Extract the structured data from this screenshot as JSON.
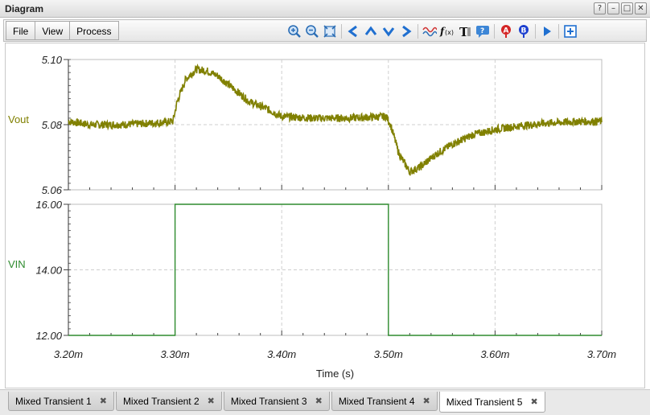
{
  "window": {
    "title": "Diagram",
    "buttons": [
      "?",
      "–",
      "□",
      "✕"
    ]
  },
  "menu": [
    "File",
    "View",
    "Process"
  ],
  "toolbar_icons": [
    "zoom-in-icon",
    "zoom-out-icon",
    "fit-icon",
    "arrow-left-icon",
    "arrow-up-icon",
    "arrow-down-icon",
    "arrow-right-icon",
    "waveform-icon",
    "function-icon",
    "text-icon",
    "comment-icon",
    "cursor-a-icon",
    "cursor-b-icon",
    "run-icon",
    "export-icon"
  ],
  "tabs": [
    {
      "label": "Mixed Transient 1",
      "active": false
    },
    {
      "label": "Mixed Transient 2",
      "active": false
    },
    {
      "label": "Mixed Transient 3",
      "active": false
    },
    {
      "label": "Mixed Transient 4",
      "active": false
    },
    {
      "label": "Mixed Transient 5",
      "active": true
    }
  ],
  "chart_data": [
    {
      "type": "line",
      "series": [
        {
          "name": "Vout",
          "color": "#808000"
        }
      ],
      "ylabel": "Vout",
      "ylim": [
        5.06,
        5.1
      ],
      "yticks": [
        "5.06",
        "5.08",
        "5.10"
      ],
      "xlim": [
        3.2,
        3.7
      ],
      "points": [
        [
          3.2,
          5.081
        ],
        [
          3.22,
          5.08
        ],
        [
          3.25,
          5.08
        ],
        [
          3.28,
          5.0805
        ],
        [
          3.298,
          5.081
        ],
        [
          3.302,
          5.087
        ],
        [
          3.31,
          5.094
        ],
        [
          3.32,
          5.097
        ],
        [
          3.33,
          5.0965
        ],
        [
          3.34,
          5.095
        ],
        [
          3.355,
          5.091
        ],
        [
          3.37,
          5.087
        ],
        [
          3.385,
          5.085
        ],
        [
          3.4,
          5.0825
        ],
        [
          3.43,
          5.082
        ],
        [
          3.46,
          5.082
        ],
        [
          3.498,
          5.0825
        ],
        [
          3.502,
          5.08
        ],
        [
          3.51,
          5.071
        ],
        [
          3.52,
          5.0655
        ],
        [
          3.53,
          5.067
        ],
        [
          3.545,
          5.071
        ],
        [
          3.56,
          5.074
        ],
        [
          3.58,
          5.077
        ],
        [
          3.6,
          5.0785
        ],
        [
          3.62,
          5.0795
        ],
        [
          3.65,
          5.0805
        ],
        [
          3.68,
          5.081
        ],
        [
          3.7,
          5.081
        ]
      ],
      "noise": 0.0012
    },
    {
      "type": "line",
      "series": [
        {
          "name": "VIN",
          "color": "#2e8b2e"
        }
      ],
      "ylabel": "VIN",
      "ylim": [
        12.0,
        16.0
      ],
      "yticks": [
        "12.00",
        "14.00",
        "16.00"
      ],
      "xlim": [
        3.2,
        3.7
      ],
      "points": [
        [
          3.2,
          12.0
        ],
        [
          3.3,
          12.0
        ],
        [
          3.3,
          16.0
        ],
        [
          3.5,
          16.0
        ],
        [
          3.5,
          12.0
        ],
        [
          3.7,
          12.0
        ]
      ]
    }
  ],
  "xaxis": {
    "label": "Time (s)",
    "ticks": [
      "3.20m",
      "3.30m",
      "3.40m",
      "3.50m",
      "3.60m",
      "3.70m"
    ],
    "values": [
      3.2,
      3.3,
      3.4,
      3.5,
      3.6,
      3.7
    ]
  }
}
